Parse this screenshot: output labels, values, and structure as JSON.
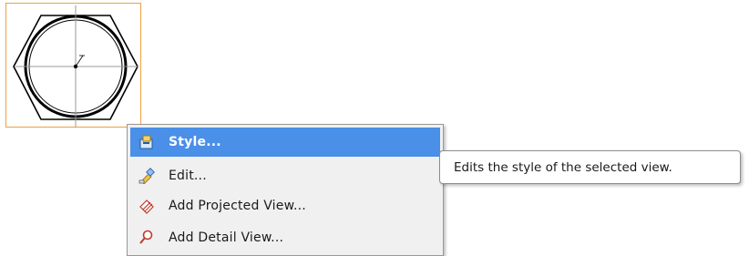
{
  "drawing_view": {
    "icon": "hex-nut-drawing-icon",
    "selected_border_color": "#f0a040"
  },
  "context_menu": {
    "items": [
      {
        "label": "Style...",
        "icon": "style-icon",
        "selected": true
      },
      {
        "label": "Edit...",
        "icon": "edit-icon",
        "selected": false
      },
      {
        "label": "Add Projected View...",
        "icon": "projected-view-icon",
        "selected": false
      },
      {
        "label": "Add Detail View...",
        "icon": "detail-view-icon",
        "selected": false
      }
    ],
    "highlight_color": "#4a8fe8"
  },
  "tooltip": {
    "text": "Edits the style of the selected view."
  }
}
